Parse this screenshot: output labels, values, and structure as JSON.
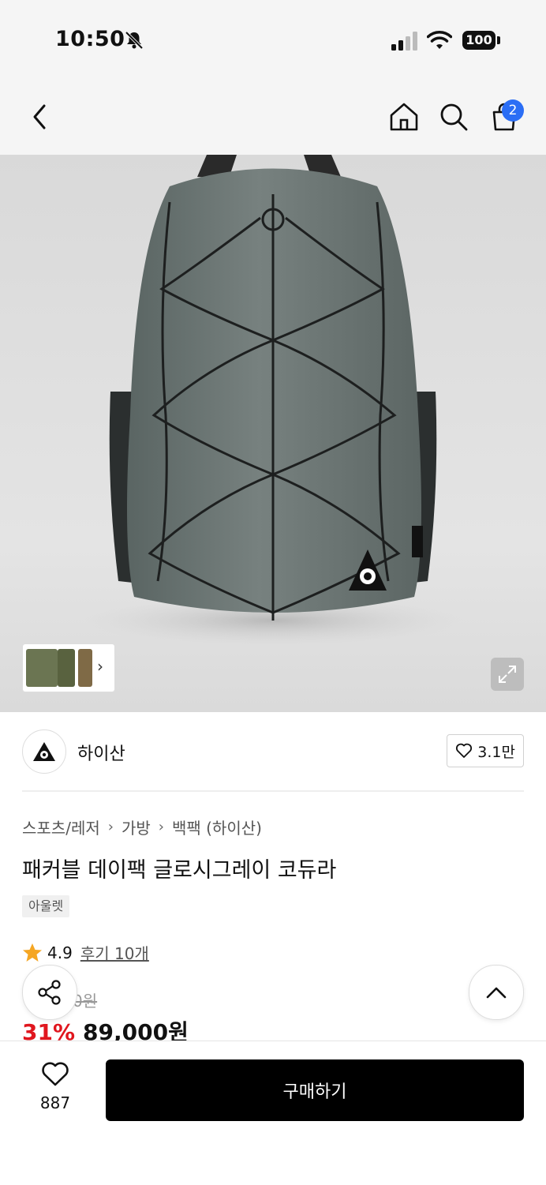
{
  "status_bar": {
    "time": "10:50",
    "battery": "100"
  },
  "nav": {
    "cart_count": "2"
  },
  "brand": {
    "name": "하이산",
    "likes": "3.1만"
  },
  "breadcrumb": [
    "스포츠/레저",
    "가방",
    "백팩 (하이산)"
  ],
  "product": {
    "title": "패커블 데이팩 글로시그레이 코듀라",
    "tag": "아울렛",
    "rating": "4.9",
    "reviews": "후기 10개",
    "original_price": "0원",
    "discount": "31%",
    "price": "89,000원"
  },
  "bottom": {
    "wish_count": "887",
    "buy_label": "구매하기"
  },
  "colors": {
    "accent_blue": "#2b6ef5",
    "discount_red": "#e0161e",
    "star": "#f5a623"
  }
}
